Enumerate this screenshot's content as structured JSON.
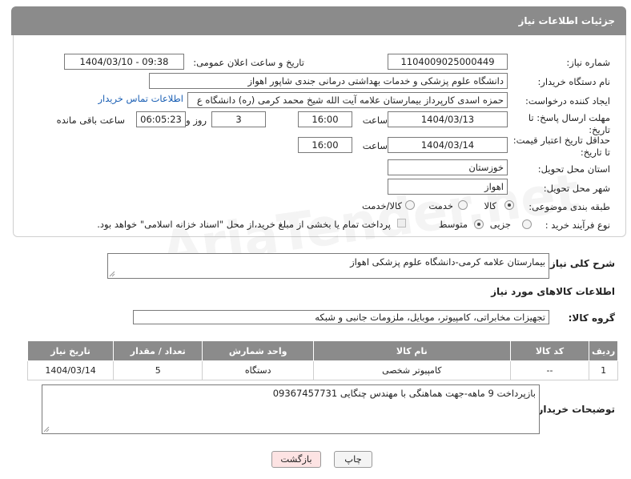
{
  "header": {
    "title": "جزئیات اطلاعات نیاز"
  },
  "form": {
    "need_number_label": "شماره نیاز:",
    "need_number": "1104009025000449",
    "announce_label": "تاریخ و ساعت اعلان عمومی:",
    "announce_value": "1404/03/10 - 09:38",
    "buyer_org_label": "نام دستگاه خریدار:",
    "buyer_org": "دانشگاه علوم پزشکی و خدمات بهداشتی درمانی جندی شاپور اهواز",
    "requester_label": "ایجاد کننده درخواست:",
    "requester": "حمزه اسدی کارپرداز بیمارستان علامه آیت الله شیخ محمد کرمی (ره) دانشگاه ع",
    "contact_link": "اطلاعات تماس خریدار",
    "deadline_label": "مهلت ارسال پاسخ: تا تاریخ:",
    "deadline_date": "1404/03/13",
    "time_label": "ساعت",
    "deadline_time": "16:00",
    "days_value": "3",
    "days_label": "روز و",
    "remaining_time": "06:05:23",
    "remaining_label": "ساعت باقی مانده",
    "price_label": "حداقل تاریخ اعتبار قیمت: تا تاریخ:",
    "price_date": "1404/03/14",
    "price_time": "16:00",
    "province_label": "استان محل تحویل:",
    "province": "خوزستان",
    "city_label": "شهر محل تحویل:",
    "city": "اهواز",
    "category_label": "طبقه بندی موضوعی:",
    "category_options": [
      "کالا",
      "خدمت",
      "کالا/خدمت"
    ],
    "process_label": "نوع فرآیند خرید :",
    "process_options": [
      "جزیی",
      "متوسط"
    ],
    "payment_note": "پرداخت تمام یا بخشی از مبلغ خرید،از محل \"اسناد خزانه اسلامی\" خواهد بود."
  },
  "summary": {
    "label": "شرح کلی نیاز:",
    "value": "بیمارستان علامه کرمی-دانشگاه علوم پزشکی اهواز"
  },
  "goods": {
    "section_title": "اطلاعات کالاهای مورد نیاز",
    "group_label": "گروه کالا:",
    "group_value": "تجهیزات مخابراتی، کامپیوتر، موبایل، ملزومات جانبی و شبکه",
    "columns": [
      "ردیف",
      "کد کالا",
      "نام کالا",
      "واحد شمارش",
      "تعداد / مقدار",
      "تاریخ نیاز"
    ],
    "rows": [
      [
        "1",
        "--",
        "کامپیوتر شخصی",
        "دستگاه",
        "5",
        "1404/03/14"
      ]
    ]
  },
  "buyer_notes": {
    "label": "توضیحات خریدار:",
    "value": "بازپرداخت 9 ماهه-جهت هماهنگی با مهندس چنگایی 09367457731"
  },
  "buttons": {
    "print": "چاپ",
    "back": "بازگشت"
  },
  "watermark": "AriaTender.net",
  "colors": {
    "header": "#8b8b8b",
    "link": "#1a5fb4",
    "back_button_bg": "#fde3e3"
  }
}
